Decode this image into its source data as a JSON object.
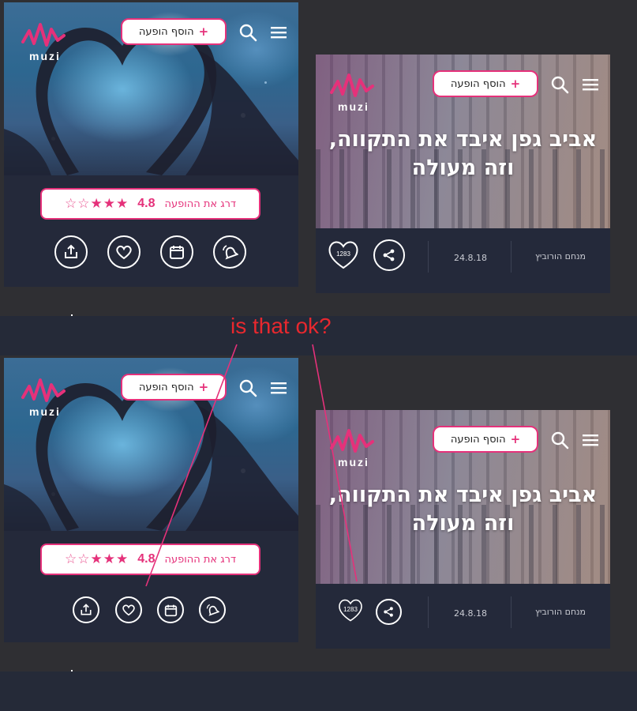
{
  "brand": {
    "logo_text": "muzi",
    "accent": "#e5317a",
    "background": "#2f2f33",
    "card": "#24293a"
  },
  "header": {
    "add_show_label": "הוסף הופעה",
    "add_show_plus": "+",
    "search_icon": "search-icon",
    "menu_icon": "hamburger-menu-icon"
  },
  "left_variant_top": {
    "rating": {
      "label": "דרג את ההופעה",
      "score": "4.8",
      "stars_filled": 3,
      "stars_total": 5
    },
    "actions": [
      "share-icon",
      "heart-icon",
      "calendar-icon",
      "notification-icon"
    ]
  },
  "left_variant_bottom": {
    "rating": {
      "label": "דרג את ההופעה",
      "score": "4.8",
      "stars_filled": 3,
      "stars_total": 5
    },
    "actions": [
      "share-icon",
      "heart-icon",
      "calendar-icon",
      "notification-icon"
    ]
  },
  "right_variant_top": {
    "title_line1": "אביב גפן איבד את התקווה,",
    "title_line2": "וזה מעולה",
    "likes": "1283",
    "date": "24.8.18",
    "author": "מנחם הורוביץ"
  },
  "right_variant_bottom": {
    "title_line1": "אביב גפן איבד את התקווה,",
    "title_line2": "וזה מעולה",
    "likes": "1283",
    "date": "24.8.18",
    "author": "מנחם הורוביץ"
  },
  "annotation": {
    "text": "is that ok?",
    "color": "#e8282e",
    "line_color": "#e5317a"
  }
}
